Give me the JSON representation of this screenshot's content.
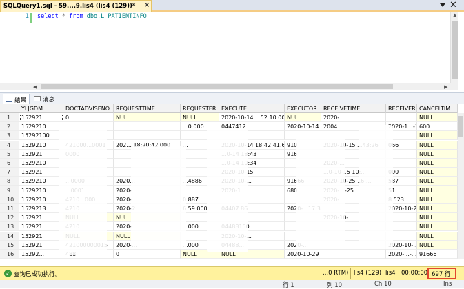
{
  "document_tab": {
    "title": "SQLQuery1.sql - 59....9.lis4 (lis4 (129))*",
    "close_glyph": "×"
  },
  "window": {
    "close_glyph": "✕"
  },
  "editor": {
    "line_number": "1",
    "keyword_select": "select",
    "star": "*",
    "keyword_from": "from",
    "object": "dbo.L_PATIENTINFO"
  },
  "result_tabs": [
    {
      "label": "结果"
    },
    {
      "label": "消息"
    }
  ],
  "grid": {
    "columns": [
      "",
      "YLJGDM",
      "DOCTADVISENO",
      "REQUESTTIME",
      "REQUESTER",
      "EXECUTE...",
      "EXECUTOR",
      "RECEIVETIME",
      "RECEIVER",
      "CANCELTIM"
    ],
    "rows": [
      [
        "1",
        "152921",
        "0",
        "NULL",
        "NULL",
        "2020-10-14 ...52:10.000",
        "NULL",
        "2020-...",
        "...",
        "NULL"
      ],
      [
        "2",
        "1529210",
        "",
        "",
        "...0:000",
        "0447412",
        "2020-10-14 18:48:34",
        "2004",
        "2020-1...-15 ...50:51",
        "600",
        "NULL"
      ],
      [
        "3",
        "15292100",
        "",
        "",
        "",
        "",
        "",
        "",
        "",
        "NULL"
      ],
      [
        "4",
        "1529210",
        "421000...0001",
        "202... 18:20:42.000",
        "...",
        "2020-10-14 18:42:41.650",
        "910",
        "2020-10-15 ...43:26",
        "066",
        "NULL"
      ],
      [
        "5",
        "152921",
        "0000",
        "",
        "",
        "...0-14 18:43",
        "916",
        "",
        "",
        "NULL"
      ],
      [
        "6",
        "1529210",
        "",
        "",
        "",
        "...0-14 10:34",
        "",
        "2020-...",
        "",
        "NULL"
      ],
      [
        "7",
        "152921",
        "",
        "",
        "",
        "2020-10-15",
        "",
        "...0-10-15 10:...",
        "000",
        "NULL"
      ],
      [
        "8",
        "1529210",
        "...0000",
        "2020...",
        "...4886",
        "2020-10-...",
        "91666",
        "2020-10-25 16:...",
        "587",
        "NULL"
      ],
      [
        "9",
        "1529210",
        "...0001",
        "2020-...",
        "...",
        "2020-1...",
        "680",
        "2020-...-25 ...",
        "51",
        "NULL"
      ],
      [
        "10",
        "1529210",
        "4210...000",
        "2020-...",
        "0.887",
        "...",
        "",
        "2020-...",
        "8.523",
        "NULL"
      ],
      [
        "11",
        "1529213",
        "4210...",
        "2020-2...",
        "6.59.000",
        "04407.86",
        "2020-...17:35",
        "",
        "2020-10-27 17:3...",
        "NULL"
      ],
      [
        "12",
        "152921",
        "NULL",
        "NULL",
        "",
        "...",
        "",
        "2020-10-...",
        "",
        "NULL"
      ],
      [
        "13",
        "152921",
        "4210...",
        "2020-...",
        "...000",
        "04488150",
        "...",
        "",
        "",
        "NULL"
      ],
      [
        "14",
        "152921",
        "NULL",
        "NULL",
        "",
        "2020-10-...",
        "",
        "",
        "",
        "NULL"
      ],
      [
        "15",
        "152921",
        "421000000015",
        "2020-...",
        "...000",
        "04488...",
        "2020-...",
        "",
        "2020-10-...09",
        "NULL"
      ],
      [
        "16",
        "15292...",
        "488",
        "0",
        "NULL",
        "NULL",
        "2020-10-29 03...",
        "",
        "2020-...-...6:000",
        "91666",
        "NULL"
      ]
    ]
  },
  "statusbar": {
    "ok_glyph": "✓",
    "message": "查询已成功执行。",
    "server": "...0 RTM)",
    "connection": "lis4 (129)",
    "database": "lis4",
    "elapsed": "00:00:00",
    "rows": "697 行"
  },
  "appstatus": {
    "line": "行 1",
    "column": "列 10",
    "char": "Ch 10",
    "mode": "Ins"
  }
}
